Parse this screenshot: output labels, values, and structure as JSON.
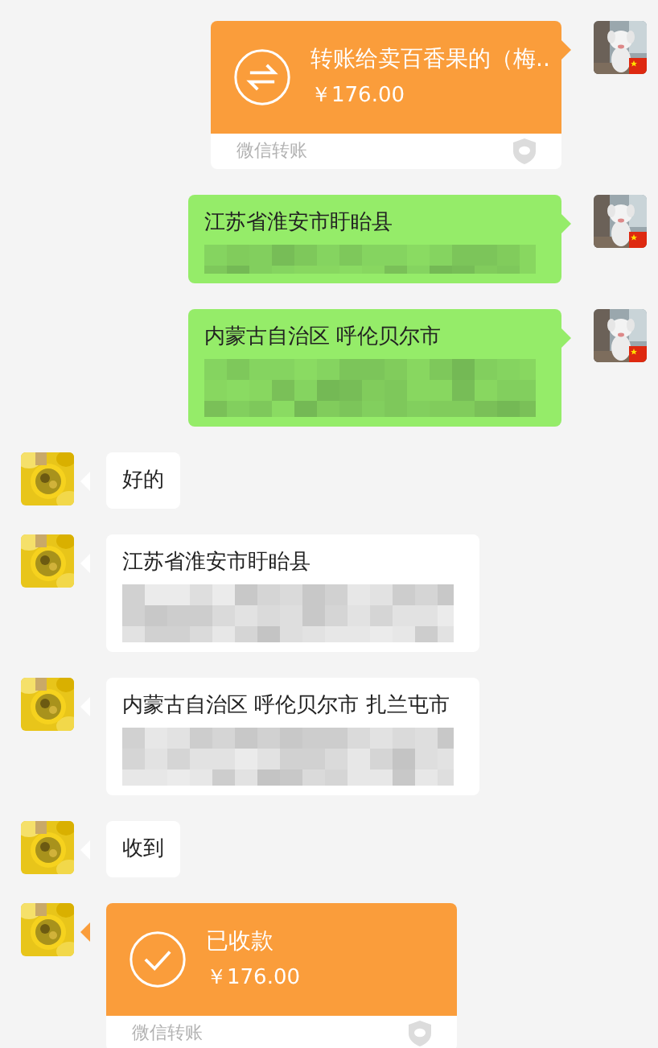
{
  "messages": [
    {
      "outgoing": true,
      "kind": "sent_transfer",
      "title": "转账给卖百香果的（梅..",
      "amount": "￥176.00",
      "footer": "微信转账"
    },
    {
      "outgoing": true,
      "kind": "text",
      "text": "江苏省淮安市盱眙县",
      "redacted": true
    },
    {
      "outgoing": true,
      "kind": "text",
      "text": "内蒙古自治区 呼伦贝尔市",
      "redacted": true
    },
    {
      "outgoing": false,
      "kind": "text",
      "text": "好的",
      "redacted": false
    },
    {
      "outgoing": false,
      "kind": "text",
      "text": "江苏省淮安市盱眙县",
      "redacted": true
    },
    {
      "outgoing": false,
      "kind": "text",
      "text": "内蒙古自治区 呼伦贝尔市 扎兰屯市",
      "redacted": true
    },
    {
      "outgoing": false,
      "kind": "text",
      "text": "收到",
      "redacted": false
    },
    {
      "outgoing": false,
      "kind": "received_transfer",
      "title": "已收款",
      "amount": "￥176.00",
      "footer": "微信转账"
    }
  ]
}
